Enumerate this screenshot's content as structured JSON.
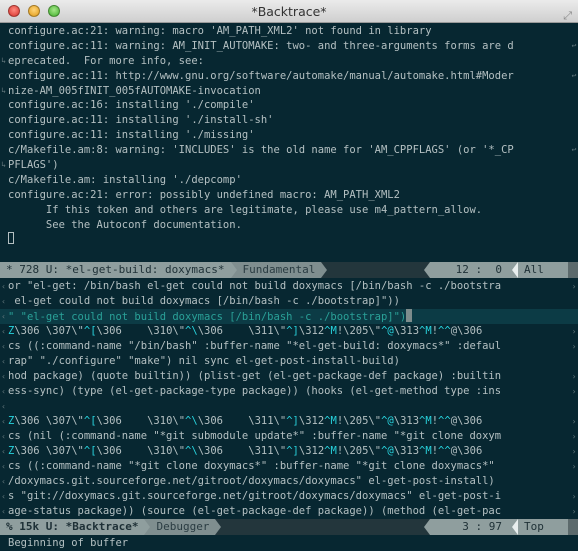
{
  "window": {
    "title": "*Backtrace*"
  },
  "top_pane": {
    "lines": [
      {
        "segs": [
          {
            "t": "configure.ac:21: warning: macro 'AM_PATH_XML2' not found in library"
          }
        ]
      },
      {
        "segs": [
          {
            "t": "configure.ac:11: warning: AM_INIT_AUTOMAKE: two- and three-arguments forms are d"
          }
        ],
        "wrap_right": true
      },
      {
        "segs": [
          {
            "t": "eprecated.  For more info, see:"
          }
        ],
        "wrap_left": true
      },
      {
        "segs": [
          {
            "t": "configure.ac:11: http://www.gnu.org/software/automake/manual/automake.html#Moder"
          }
        ],
        "wrap_right": true
      },
      {
        "segs": [
          {
            "t": "nize-AM_005fINIT_005fAUTOMAKE-invocation"
          }
        ],
        "wrap_left": true
      },
      {
        "segs": [
          {
            "t": "configure.ac:16: installing './compile'"
          }
        ]
      },
      {
        "segs": [
          {
            "t": "configure.ac:11: installing './install-sh'"
          }
        ]
      },
      {
        "segs": [
          {
            "t": "configure.ac:11: installing './missing'"
          }
        ]
      },
      {
        "segs": [
          {
            "t": "c/Makefile.am:8: warning: 'INCLUDES' is the old name for 'AM_CPPFLAGS' (or '*_CP"
          }
        ],
        "wrap_right": true
      },
      {
        "segs": [
          {
            "t": "PFLAGS')"
          }
        ],
        "wrap_left": true
      },
      {
        "segs": [
          {
            "t": "c/Makefile.am: installing './depcomp'"
          }
        ]
      },
      {
        "segs": [
          {
            "t": "configure.ac:21: error: possibly undefined macro: AM_PATH_XML2"
          }
        ]
      },
      {
        "segs": [
          {
            "t": "      If this token and others are legitimate, please use m4_pattern_allow."
          }
        ]
      },
      {
        "segs": [
          {
            "t": "      See the Autoconf documentation."
          }
        ]
      },
      {
        "segs": [],
        "cursor": true
      }
    ]
  },
  "top_modeline": {
    "buffer": "* 728 U: *el-get-build: doxymacs*",
    "mode": "Fundamental",
    "position": "12 :  0",
    "scroll": "All"
  },
  "bottom_pane": {
    "lines": [
      {
        "segs": [
          {
            "t": "or \"el-get: /bin/bash el-get could not build doxymacs [/bin/bash -c ./bootstra"
          }
        ],
        "trunc_right": true
      },
      {
        "segs": [
          {
            "t": " el-get could not build doxymacs [/bin/bash -c ./bootstrap]\"))"
          }
        ]
      },
      {
        "segs": [
          {
            "t": "\" \"el-get could not build doxymacs [/bin/bash -c ./bootstrap]\")"
          }
        ],
        "highlight": true,
        "cursor": true
      },
      {
        "segs": [
          {
            "t": "Z",
            "k": true
          },
          {
            "t": "\\306 \\307\\\""
          },
          {
            "t": "^[",
            "k": true
          },
          {
            "t": "\\306    \\310\\\""
          },
          {
            "t": "^\\",
            "k": true
          },
          {
            "t": "\\306    \\311\\\""
          },
          {
            "t": "^]",
            "k": true
          },
          {
            "t": "\\312"
          },
          {
            "t": "^M",
            "k": true
          },
          {
            "t": "!\\205\\\""
          },
          {
            "t": "^@",
            "k": true
          },
          {
            "t": "\\313"
          },
          {
            "t": "^M",
            "k": true
          },
          {
            "t": "!"
          },
          {
            "t": "^^",
            "k": true
          },
          {
            "t": "@\\306"
          }
        ],
        "trunc_right": true
      },
      {
        "segs": [
          {
            "t": "cs ((:command-name \"/bin/bash\" :buffer-name \"*el-get-build: doxymacs*\" :defaul"
          }
        ],
        "trunc_right": true
      },
      {
        "segs": [
          {
            "t": "rap\" \"./configure\" \"make\") nil sync el-get-post-install-build)"
          }
        ]
      },
      {
        "segs": [
          {
            "t": "hod package) (quote builtin)) (plist-get (el-get-package-def package) :builtin"
          }
        ],
        "trunc_right": true
      },
      {
        "segs": [
          {
            "t": "ess-sync) (type (el-get-package-type package)) (hooks (el-get-method type :ins"
          }
        ],
        "trunc_right": true
      },
      {
        "segs": []
      },
      {
        "segs": [
          {
            "t": "Z",
            "k": true
          },
          {
            "t": "\\306 \\307\\\""
          },
          {
            "t": "^[",
            "k": true
          },
          {
            "t": "\\306    \\310\\\""
          },
          {
            "t": "^\\",
            "k": true
          },
          {
            "t": "\\306    \\311\\\""
          },
          {
            "t": "^]",
            "k": true
          },
          {
            "t": "\\312"
          },
          {
            "t": "^M",
            "k": true
          },
          {
            "t": "!\\205\\\""
          },
          {
            "t": "^@",
            "k": true
          },
          {
            "t": "\\313"
          },
          {
            "t": "^M",
            "k": true
          },
          {
            "t": "!"
          },
          {
            "t": "^^",
            "k": true
          },
          {
            "t": "@\\306"
          }
        ],
        "trunc_right": true
      },
      {
        "segs": [
          {
            "t": "cs (nil (:command-name \"*git submodule update*\" :buffer-name \"*git clone doxym"
          }
        ],
        "trunc_right": true
      },
      {
        "segs": [
          {
            "t": "Z",
            "k": true
          },
          {
            "t": "\\306 \\307\\\""
          },
          {
            "t": "^[",
            "k": true
          },
          {
            "t": "\\306    \\310\\\""
          },
          {
            "t": "^\\",
            "k": true
          },
          {
            "t": "\\306    \\311\\\""
          },
          {
            "t": "^]",
            "k": true
          },
          {
            "t": "\\312"
          },
          {
            "t": "^M",
            "k": true
          },
          {
            "t": "!\\205\\\""
          },
          {
            "t": "^@",
            "k": true
          },
          {
            "t": "\\313"
          },
          {
            "t": "^M",
            "k": true
          },
          {
            "t": "!"
          },
          {
            "t": "^^",
            "k": true
          },
          {
            "t": "@\\306"
          }
        ],
        "trunc_right": true
      },
      {
        "segs": [
          {
            "t": "cs ((:command-name \"*git clone doxymacs*\" :buffer-name \"*git clone doxymacs*\""
          }
        ],
        "trunc_right": true
      },
      {
        "segs": [
          {
            "t": "/doxymacs.git.sourceforge.net/gitroot/doxymacs/doxymacs\" el-get-post-install)"
          }
        ]
      },
      {
        "segs": [
          {
            "t": "s \"git://doxymacs.git.sourceforge.net/gitroot/doxymacs/doxymacs\" el-get-post-i"
          }
        ],
        "trunc_right": true
      },
      {
        "segs": [
          {
            "t": "age-status package)) (source (el-get-package-def package)) (method (el-get-pac"
          }
        ],
        "trunc_right": true
      }
    ]
  },
  "bottom_modeline": {
    "buffer": "% 15k U: *Backtrace*",
    "mode": "Debugger",
    "position": "3 : 97",
    "scroll": "Top"
  },
  "echo_area": {
    "message": "Beginning of buffer"
  },
  "colors": {
    "background": "#072731",
    "text": "#b4c0c2",
    "control_char": "#28d3dd",
    "highlight_line_text": "#2aa198",
    "modeline": "#8f9e9e"
  }
}
